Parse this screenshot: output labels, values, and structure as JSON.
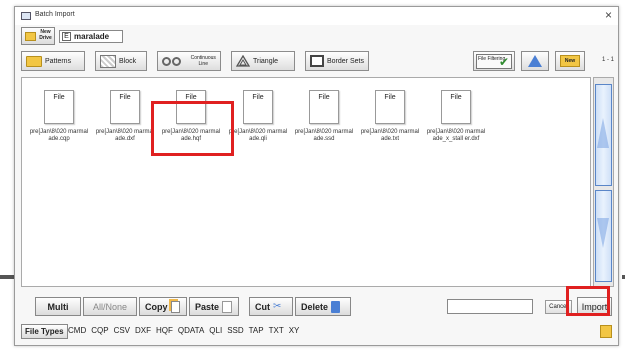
{
  "window": {
    "title": "Batch Import",
    "close_glyph": "×"
  },
  "drive": {
    "new_drive_label": "New Drive",
    "letter": "E",
    "name": "maralade"
  },
  "toolbar": {
    "patterns": "Patterns",
    "block": "Block",
    "continuous_line": "Continuous Line",
    "triangle": "Triangle",
    "border_sets": "Border Sets",
    "file_filtering": "File Filtering",
    "new_folder": "New",
    "page_indicator": "1 - 1"
  },
  "files": [
    {
      "icon_label": "File",
      "name": "pre[Jan\\8\\020 marmalade.cqp"
    },
    {
      "icon_label": "File",
      "name": "pre[Jan\\8\\020 marmalade.dxf"
    },
    {
      "icon_label": "File",
      "name": "pre[Jan\\8\\020 marmalade.hqf"
    },
    {
      "icon_label": "File",
      "name": "pre[Jan\\8\\020 marmalade.qli"
    },
    {
      "icon_label": "File",
      "name": "pre[Jan\\8\\020 marmalade.ssd"
    },
    {
      "icon_label": "File",
      "name": "pre[Jan\\8\\020 marmalade.txt"
    },
    {
      "icon_label": "File",
      "name": "pre[Jan\\8\\020 marmalade_x_stall er.dxf"
    }
  ],
  "actions": {
    "multi": "Multi",
    "all_none": "All/None",
    "copy": "Copy",
    "paste": "Paste",
    "cut": "Cut",
    "delete": "Delete",
    "filename_value": "",
    "cancel": "Cancel",
    "import": "Import"
  },
  "file_types": {
    "label": "File Types",
    "items": [
      "CMD",
      "CQP",
      "CSV",
      "DXF",
      "HQF",
      "QDATA",
      "QLI",
      "SSD",
      "TAP",
      "TXT",
      "XY"
    ]
  },
  "colors": {
    "highlight": "#e02020",
    "accent_blue": "#4a7fd4",
    "folder_yellow": "#f2c644"
  }
}
